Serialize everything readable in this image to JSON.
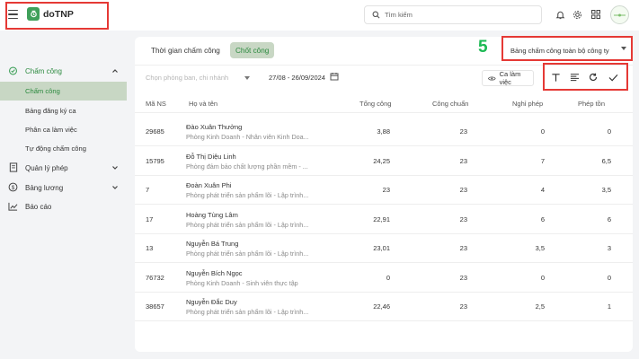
{
  "app": {
    "name": "doTNP"
  },
  "search": {
    "placeholder": "Tìm kiếm"
  },
  "sidebar": {
    "groups": [
      {
        "label": "Chấm công"
      },
      {
        "label": "Quản lý phép"
      },
      {
        "label": "Bảng lương"
      },
      {
        "label": "Báo cáo"
      }
    ],
    "items": [
      {
        "label": "Chấm công"
      },
      {
        "label": "Bảng đăng ký ca"
      },
      {
        "label": "Phân ca làm việc"
      },
      {
        "label": "Tự động chấm công"
      }
    ]
  },
  "tabs": [
    {
      "label": "Thời gian chấm công"
    },
    {
      "label": "Chốt công"
    }
  ],
  "annotation_number": "5",
  "company_select": {
    "value": "Bảng chấm công toàn bộ công ty"
  },
  "filters": {
    "dept_placeholder": "Chọn phòng ban, chi nhánh",
    "date_range": "27/08 - 26/09/2024",
    "shift_label": "Ca làm việc"
  },
  "table": {
    "headers": [
      "Mã NS",
      "Họ và tên",
      "Tổng công",
      "Công chuẩn",
      "Nghỉ phép",
      "Phép tồn"
    ],
    "rows": [
      {
        "id": "29685",
        "name": "Đào Xuân Thưởng",
        "dept": "Phòng Kinh Doanh - Nhân viên Kinh Doa...",
        "total": "3,88",
        "standard": "23",
        "leave": "0",
        "remaining": "0"
      },
      {
        "id": "15795",
        "name": "Đỗ Thị Diệu Linh",
        "dept": "Phòng đảm bảo chất lượng phần mềm - ...",
        "total": "24,25",
        "standard": "23",
        "leave": "7",
        "remaining": "6,5"
      },
      {
        "id": "7",
        "name": "Đoàn Xuân Phi",
        "dept": "Phòng phát triển sản phẩm lõi - Lập trình...",
        "total": "23",
        "standard": "23",
        "leave": "4",
        "remaining": "3,5"
      },
      {
        "id": "17",
        "name": "Hoàng Tùng Lâm",
        "dept": "Phòng phát triển sản phẩm lõi - Lập trình...",
        "total": "22,91",
        "standard": "23",
        "leave": "6",
        "remaining": "6"
      },
      {
        "id": "13",
        "name": "Nguyễn Bá Trung",
        "dept": "Phòng phát triển sản phẩm lõi - Lập trình...",
        "total": "23,01",
        "standard": "23",
        "leave": "3,5",
        "remaining": "3"
      },
      {
        "id": "76732",
        "name": "Nguyễn Bích Ngọc",
        "dept": "Phòng Kinh Doanh - Sinh viên thực tập",
        "total": "0",
        "standard": "23",
        "leave": "0",
        "remaining": "0"
      },
      {
        "id": "38657",
        "name": "Nguyễn Đắc Duy",
        "dept": "Phòng phát triển sản phẩm lõi - Lập trình...",
        "total": "22,46",
        "standard": "23",
        "leave": "2,5",
        "remaining": "1"
      }
    ]
  },
  "colors": {
    "brand": "#3fa05a",
    "highlight": "#e53935",
    "active_bg": "#c8d7c4",
    "annotation": "#1db954"
  }
}
